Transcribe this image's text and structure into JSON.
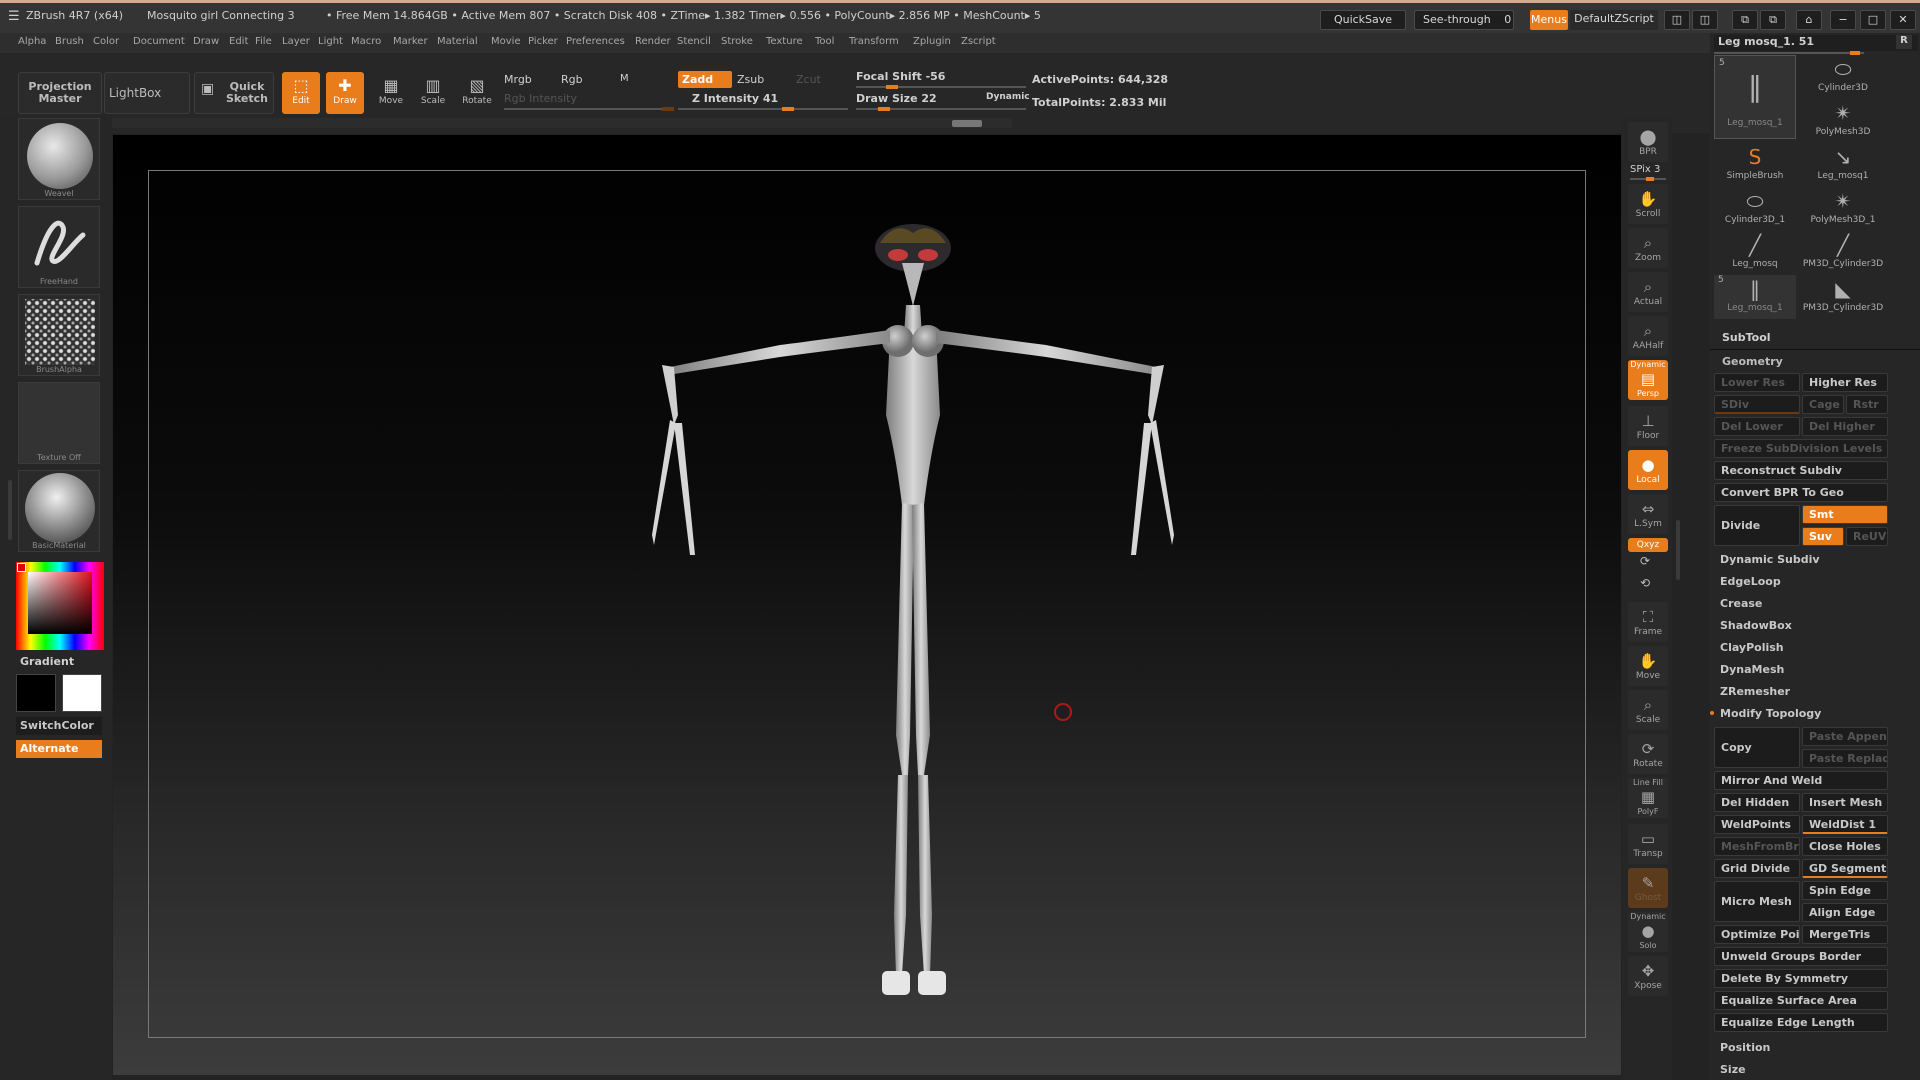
{
  "titlebar": {
    "app": "ZBrush 4R7 (x64)",
    "document": "Mosquito girl Connecting 3",
    "stats": "• Free Mem 14.864GB • Active Mem 807 • Scratch Disk 408 • ZTime▸ 1.382 Timer▸ 0.556 • PolyCount▸ 2.856 MP • MeshCount▸ 5",
    "quicksave": "QuickSave",
    "seethrough": "See-through",
    "seethrough_value": "0",
    "menus": "Menus",
    "script": "DefaultZScript"
  },
  "menubar": [
    "Alpha",
    "Brush",
    "Color",
    "Document",
    "Draw",
    "Edit",
    "File",
    "Layer",
    "Light",
    "Macro",
    "Marker",
    "Material",
    "Movie",
    "Picker",
    "Preferences",
    "Render",
    "Stencil",
    "Stroke",
    "Texture",
    "Tool",
    "Transform",
    "Zplugin",
    "Zscript"
  ],
  "toolbar": {
    "projection_master": "Projection Master",
    "lightbox": "LightBox",
    "quick_sketch": "Quick Sketch",
    "edit": "Edit",
    "draw": "Draw",
    "move": "Move",
    "scale": "Scale",
    "rotate": "Rotate",
    "mrgb": "Mrgb",
    "rgb": "Rgb",
    "m": "M",
    "rgb_intensity": "Rgb Intensity",
    "zadd": "Zadd",
    "zsub": "Zsub",
    "zcut": "Zcut",
    "z_intensity": "Z Intensity 41",
    "focal_shift": "Focal Shift -56",
    "draw_size": "Draw Size 22",
    "dynamic": "Dynamic",
    "active_points": "ActivePoints: 644,328",
    "total_points": "TotalPoints: 2.833 Mil"
  },
  "leftpanel": {
    "brush": "Weavel",
    "stroke": "FreeHand",
    "alpha": "BrushAlpha",
    "texture": "Texture Off",
    "material": "BasicMaterial",
    "gradient": "Gradient",
    "switchcolor": "SwitchColor",
    "alternate": "Alternate"
  },
  "rightstrip": {
    "bpr": "BPR",
    "spix": "SPix 3",
    "scroll": "Scroll",
    "zoom": "Zoom",
    "actual": "Actual",
    "aahalf": "AAHalf",
    "dynamic": "Dynamic",
    "persp": "Persp",
    "floor": "Floor",
    "local": "Local",
    "lsym": "L.Sym",
    "xyz": "Qxyz",
    "frame": "Frame",
    "move": "Move",
    "scale": "Scale",
    "rotate": "Rotate",
    "linefill": "Line Fill",
    "polyf": "PolyF",
    "transp": "Transp",
    "ghost": "Ghost",
    "dynamic2": "Dynamic",
    "solo": "Solo",
    "xpose": "Xpose"
  },
  "rpanel": {
    "tool_name": "Leg mosq_1. 51",
    "r": "R",
    "thumbs": [
      {
        "label": "Leg_mosq_1",
        "count": "5"
      },
      {
        "label": "Cylinder3D",
        "count": ""
      },
      {
        "label": "PolyMesh3D",
        "count": ""
      },
      {
        "label": "SimpleBrush",
        "count": ""
      },
      {
        "label": "Leg_mosq1",
        "count": ""
      },
      {
        "label": "Cylinder3D_1",
        "count": ""
      },
      {
        "label": "PolyMesh3D_1",
        "count": ""
      },
      {
        "label": "Leg_mosq",
        "count": ""
      },
      {
        "label": "PM3D_Cylinder3D",
        "count": ""
      },
      {
        "label": "Leg_mosq_1",
        "count": "5"
      },
      {
        "label": "PM3D_Cylinder3D",
        "count": ""
      }
    ],
    "subtool": "SubTool",
    "geometry": "Geometry",
    "lower_res": "Lower Res",
    "higher_res": "Higher Res",
    "sdiv": "SDiv",
    "cage": "Cage",
    "rstr": "Rstr",
    "del_lower": "Del Lower",
    "del_higher": "Del Higher",
    "freeze": "Freeze SubDivision Levels",
    "reconstruct": "Reconstruct Subdiv",
    "convert_bpr": "Convert BPR To Geo",
    "divide": "Divide",
    "smt": "Smt",
    "suv": "Suv",
    "reuv": "ReUV",
    "dynamic_subdiv": "Dynamic Subdiv",
    "edgeloop": "EdgeLoop",
    "crease": "Crease",
    "shadowbox": "ShadowBox",
    "claypolish": "ClayPolish",
    "dynamesh": "DynaMesh",
    "zremesher": "ZRemesher",
    "modify_topology": "Modify Topology",
    "copy": "Copy",
    "paste_append": "Paste Append",
    "paste_replace": "Paste Replace",
    "mirror_weld": "Mirror And Weld",
    "del_hidden": "Del Hidden",
    "insert_mesh": "Insert Mesh",
    "weldpoints": "WeldPoints",
    "welddist": "WeldDist 1",
    "meshfrombrush": "MeshFromBrush",
    "close_holes": "Close Holes",
    "grid_divide": "Grid Divide",
    "gd_segments": "GD Segments",
    "spin_edge": "Spin Edge",
    "micro_mesh": "Micro Mesh",
    "align_edge": "Align Edge",
    "optimize": "Optimize Points",
    "mergetris": "MergeTris",
    "unweld": "Unweld Groups Border",
    "del_symmetry": "Delete By Symmetry",
    "equalize_area": "Equalize Surface Area",
    "equalize_edge": "Equalize Edge Length",
    "position": "Position",
    "size": "Size"
  },
  "colors": {
    "accent": "#e97c1b",
    "panel": "#262626",
    "background": "#232323"
  }
}
